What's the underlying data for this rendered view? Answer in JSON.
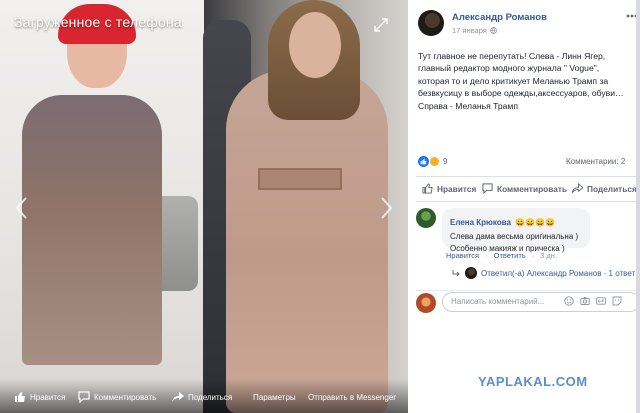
{
  "viewer": {
    "title": "Загруженное с телефона",
    "bar": {
      "like": "Нравится",
      "comment": "Комментировать",
      "share": "Поделиться",
      "params": "Параметры",
      "messenger": "Отправить в Messenger"
    }
  },
  "post": {
    "author": "Александр Романов",
    "date": "17 января",
    "text": "Тут главное не перепутать! Слева - Линн Ягер, главный редактор модного журнала \" Vogue\", которая то и дело критикует Меланью Трамп за безвкусицу в выборе одежды,аксессуаров, обуви…Справа - Меланья Трамп",
    "reactions_count": "9",
    "comments_count": "Комментарии: 2",
    "actions": {
      "like": "Нравится",
      "comment": "Комментировать",
      "share": "Поделиться"
    }
  },
  "comment": {
    "author": "Елена Крюкова",
    "emoji": "😄😄😄😄",
    "line1": "Слева дама весьма оригинальна )",
    "line2": "Особенно макияж и прическа )",
    "meta": {
      "like": "Нравится",
      "reply": "Ответить",
      "time": "3 дн."
    },
    "reply_summary": "Ответил(-а) Александр Романов · 1 ответ"
  },
  "composer": {
    "placeholder": "Написать комментарий..."
  },
  "watermark": "YAPLAKAL.COM",
  "colors": {
    "link": "#385898",
    "like_blue": "#1877f2",
    "watermark": "#5b8fcb"
  }
}
